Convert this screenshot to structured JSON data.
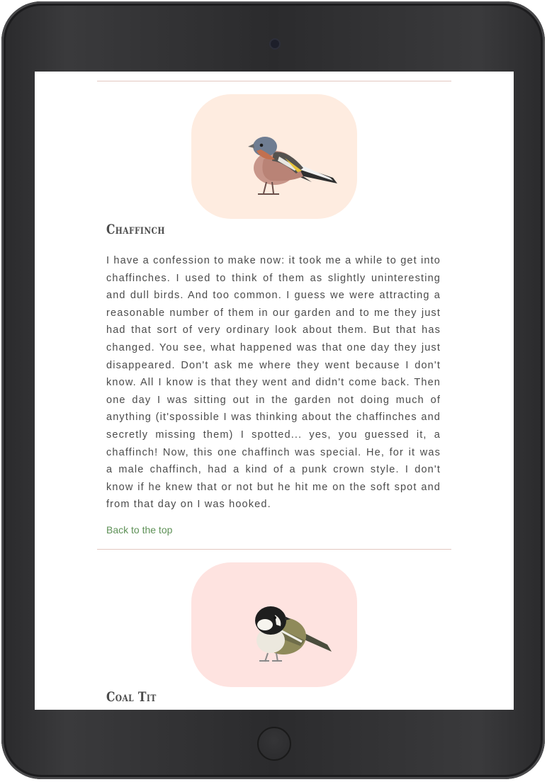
{
  "birds": [
    {
      "name": "Chaffinch",
      "frame_color": "#feece0",
      "text": "I have a confession to make now: it took me a while to get into chaffinches. I used to think of them as slightly uninteresting and dull birds. And too common. I guess we were attracting a reasonable number of them in our garden and to me they just had that sort of very ordinary look about them. But that has changed. You see, what happened was that one day they just disappeared. Don't ask me where they went because I don't know. All I know is that they went and didn't come back. Then one day I was sitting out in the garden not doing much of anything (it'spossible I was thinking about the chaffinches and secretly missing them) I spotted... yes, you guessed it, a chaffinch! Now, this one chaffinch was special. He, for it was a male chaffinch, had a kind of a punk crown style. I don't know if he knew that or not but he hit me on the soft spot and from that day on I was hooked.",
      "back_link": "Back to the top"
    },
    {
      "name": "Coal Tit",
      "frame_color": "#fee3e0"
    }
  ],
  "colors": {
    "divider": "#e3c7c0",
    "link": "#5e9157",
    "heading": "#4a4a4a",
    "body_text": "#4b4b4b"
  }
}
